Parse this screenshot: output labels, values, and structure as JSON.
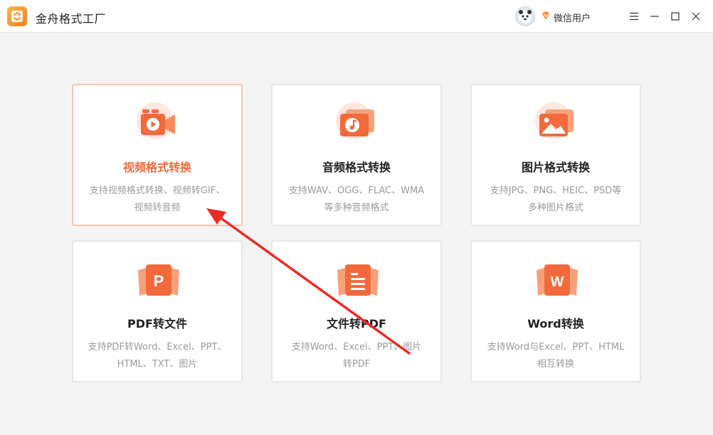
{
  "app": {
    "title": "金舟格式工厂"
  },
  "user": {
    "name": "微信用户"
  },
  "colors": {
    "accent": "#f26a3c",
    "arrow": "#ee2a24"
  },
  "cards": [
    {
      "title": "视频格式转换",
      "desc1": "支持视频格式转换、视频转GIF、",
      "desc2": "视频转音频",
      "icon": "video-play-icon"
    },
    {
      "title": "音频格式转换",
      "desc1": "支持WAV、OGG、FLAC、WMA",
      "desc2": "等多种音频格式",
      "icon": "music-note-icon"
    },
    {
      "title": "图片格式转换",
      "desc1": "支持JPG、PNG、HEIC、PSD等",
      "desc2": "多种图片格式",
      "icon": "image-icon"
    },
    {
      "title": "PDF转文件",
      "desc1": "支持PDF转Word、Excel、PPT、",
      "desc2": "HTML、TXT、图片",
      "icon": "pdf-p-icon"
    },
    {
      "title": "文件转PDF",
      "desc1": "支持Word、Excel、PPT、图片",
      "desc2": "转PDF",
      "icon": "document-lines-icon"
    },
    {
      "title": "Word转换",
      "desc1": "支持Word与Excel、PPT、HTML",
      "desc2": "相互转换",
      "icon": "word-w-icon"
    }
  ]
}
